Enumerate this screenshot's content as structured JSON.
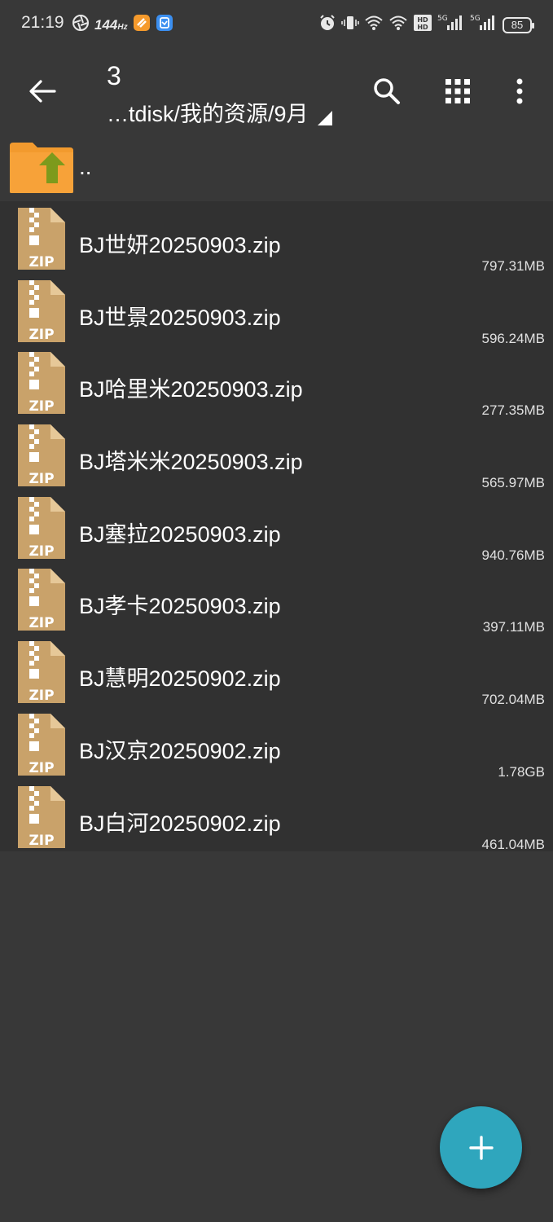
{
  "status_bar": {
    "time": "21:19",
    "refresh_rate": "144",
    "refresh_unit": "Hz",
    "battery": "85",
    "network_1": "5G",
    "network_2": "5G"
  },
  "toolbar": {
    "title": "3",
    "path": "…tdisk/我的资源/9月"
  },
  "parent_entry": {
    "label": ".."
  },
  "files": [
    {
      "name": "BJ世妍20250903.zip",
      "size": "797.31MB"
    },
    {
      "name": "BJ世景20250903.zip",
      "size": "596.24MB"
    },
    {
      "name": "BJ哈里米20250903.zip",
      "size": "277.35MB"
    },
    {
      "name": "BJ塔米米20250903.zip",
      "size": "565.97MB"
    },
    {
      "name": "BJ塞拉20250903.zip",
      "size": "940.76MB"
    },
    {
      "name": "BJ孝卡20250903.zip",
      "size": "397.11MB"
    },
    {
      "name": "BJ慧明20250902.zip",
      "size": "702.04MB"
    },
    {
      "name": "BJ汉京20250902.zip",
      "size": "1.78GB"
    },
    {
      "name": "BJ白河20250902.zip",
      "size": "461.04MB"
    }
  ],
  "icons": {
    "zip_label": "ZIP"
  },
  "colors": {
    "background": "#383838",
    "list_background": "#313131",
    "folder_orange": "#f7a239",
    "up_arrow_green": "#7d9a1c",
    "zip_tan": "#c9a26a",
    "fab": "#2fa6bd"
  }
}
